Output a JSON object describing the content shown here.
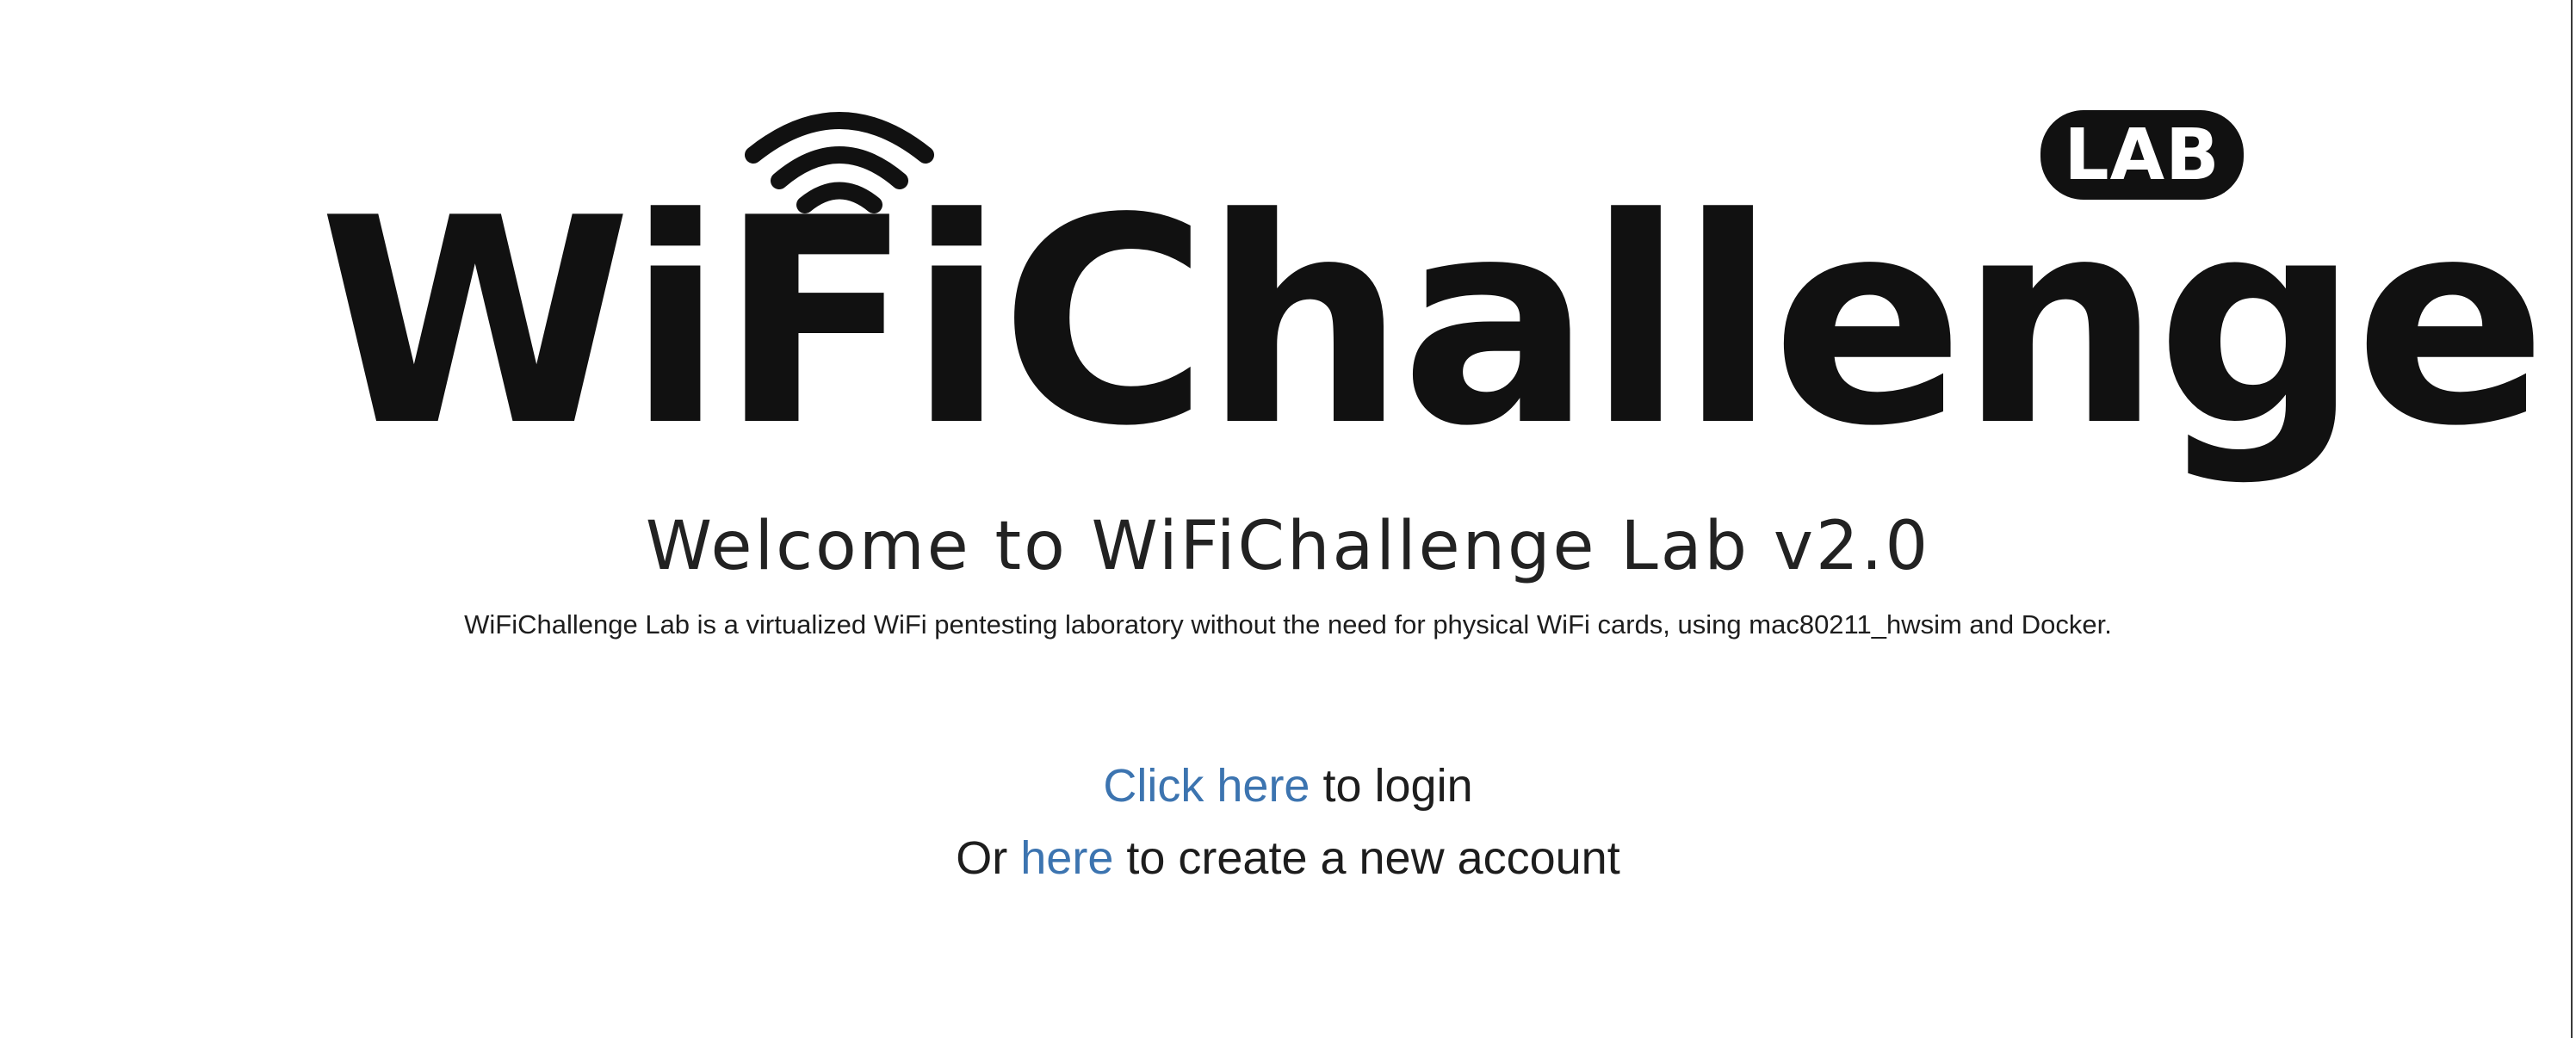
{
  "logo": {
    "wordmark": "WiFiChallenge",
    "badge": "LAB",
    "icon": "wifi-signal-icon"
  },
  "welcome": {
    "title": "Welcome to WiFiChallenge Lab v2.0",
    "description": "WiFiChallenge Lab is a virtualized WiFi pentesting laboratory without the need for physical WiFi cards, using mac80211_hwsim and Docker."
  },
  "login": {
    "link_text": "Click here",
    "suffix": " to login"
  },
  "signup": {
    "prefix": "Or ",
    "link_text": "here",
    "suffix": " to create a new account"
  },
  "colors": {
    "link": "#3c74b0",
    "text": "#1d1d1d",
    "logo": "#111111"
  }
}
